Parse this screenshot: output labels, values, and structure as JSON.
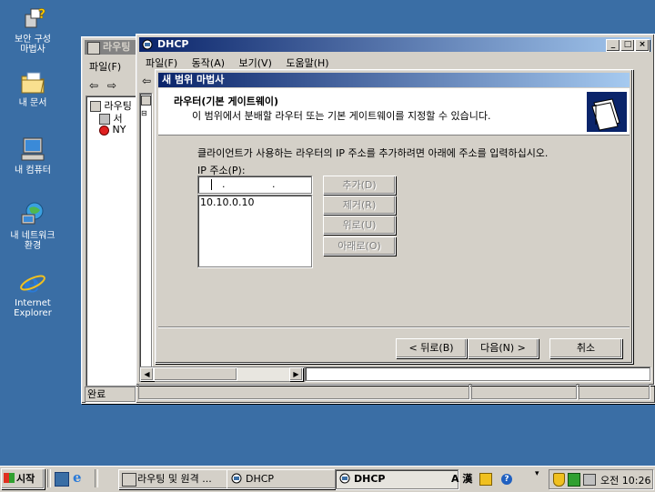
{
  "desktop": {
    "icons": [
      {
        "name": "security-wizard",
        "label": "보안 구성\n마법사"
      },
      {
        "name": "my-documents",
        "label": "내 문서"
      },
      {
        "name": "my-computer",
        "label": "내 컴퓨터"
      },
      {
        "name": "my-network",
        "label": "내 네트워크\n환경"
      },
      {
        "name": "internet-explorer",
        "label": "Internet\nExplorer"
      }
    ]
  },
  "routing_window": {
    "title": "라우팅",
    "menu_file": "파일(F)",
    "tree": [
      "라우팅",
      "서",
      "NY"
    ],
    "status": "완료"
  },
  "dhcp_window": {
    "title": "DHCP",
    "menu": [
      "파일(F)",
      "동작(A)",
      "보기(V)",
      "도움말(H)"
    ],
    "tree_node": ""
  },
  "wizard": {
    "title": "새 범위 마법사",
    "header_title": "라우터(기본 게이트웨이)",
    "header_subtitle": "이 범위에서 분배할 라우터 또는 기본 게이트웨이를 지정할 수 있습니다.",
    "instruction": "클라이언트가 사용하는 라우터의 IP 주소를 추가하려면 아래에 주소를 입력하십시오.",
    "ip_label": "IP 주소(P):",
    "ip_input_value": ". . .",
    "address_list": [
      "10.10.0.10"
    ],
    "buttons": {
      "add": "추가(D)",
      "remove": "제거(R)",
      "up": "위로(U)",
      "down": "아래로(O)",
      "back": "< 뒤로(B)",
      "next": "다음(N) >",
      "cancel": "취소"
    }
  },
  "taskbar": {
    "start": "시작",
    "tasks": [
      {
        "label": "라우팅 및 원격 ...",
        "pressed": false
      },
      {
        "label": "DHCP",
        "pressed": false
      },
      {
        "label": "DHCP",
        "pressed": true
      }
    ],
    "ime": "A 漢",
    "clock": "오전 10:26"
  },
  "colors": {
    "desktop": "#3a6ea5",
    "title_active": "#0a246a",
    "window_face": "#d4d0c8"
  }
}
